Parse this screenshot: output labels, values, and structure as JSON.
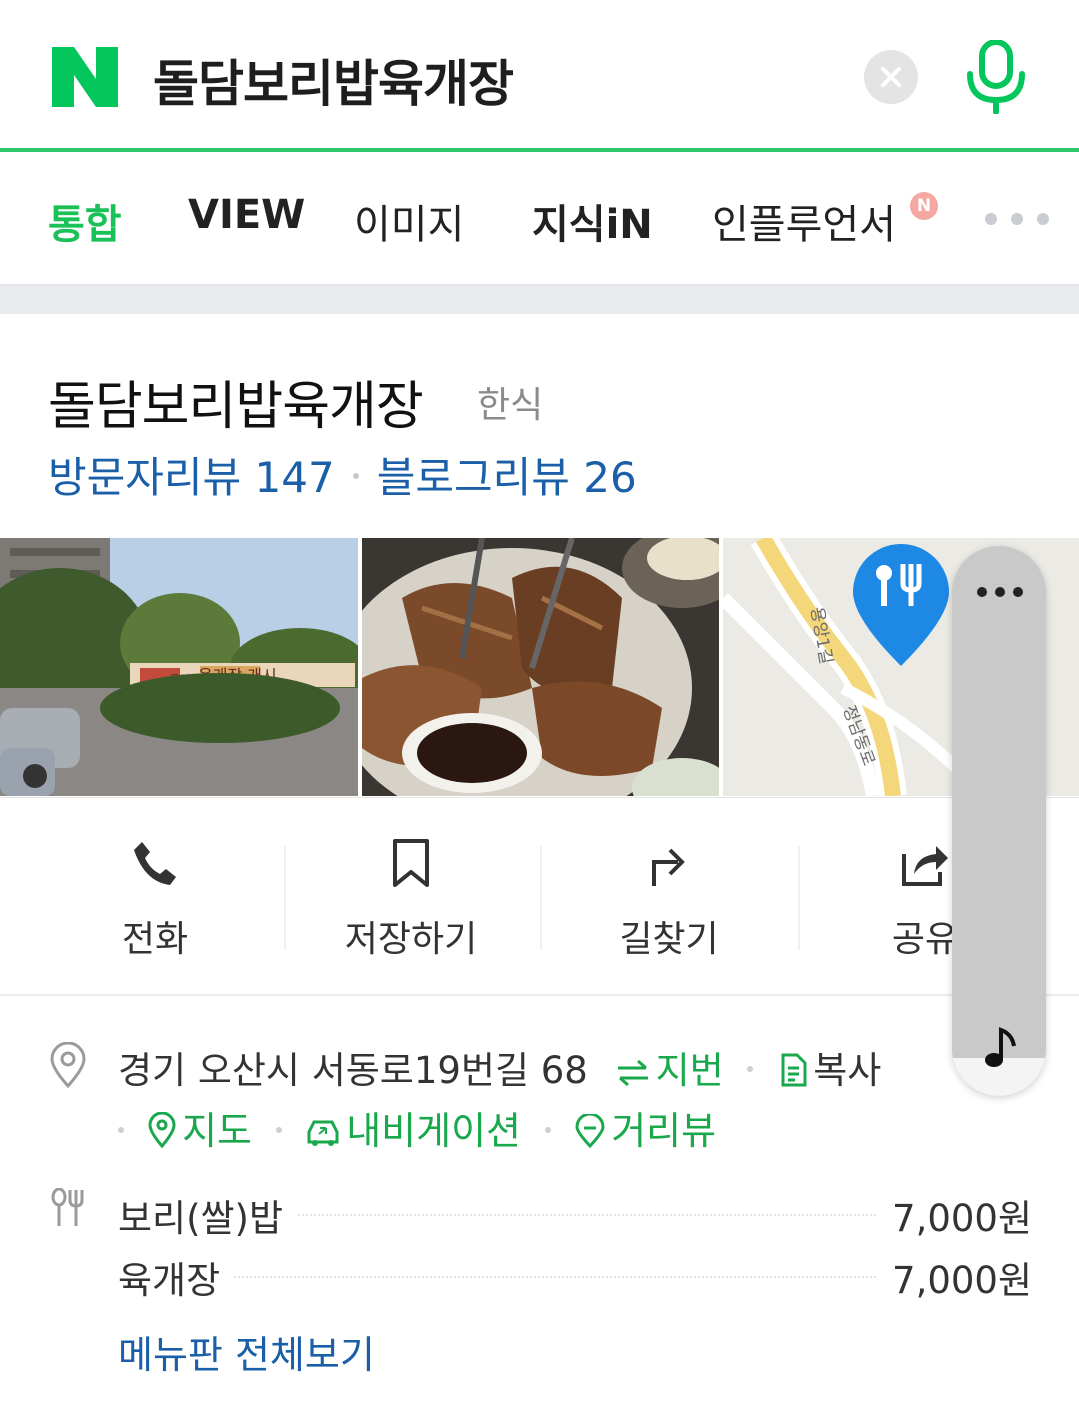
{
  "search": {
    "query": "돌담보리밥육개장",
    "logo_letter": "N",
    "clear_icon": "close-icon",
    "mic_icon": "microphone-icon"
  },
  "tabs": [
    {
      "label": "통합",
      "active": true
    },
    {
      "label": "VIEW",
      "active": false
    },
    {
      "label": "이미지",
      "active": false
    },
    {
      "label": "지식iN",
      "active": false
    },
    {
      "label": "인플루언서",
      "active": false,
      "badge": "N"
    }
  ],
  "place": {
    "name": "돌담보리밥육개장",
    "category": "한식",
    "visitor_reviews": "방문자리뷰 147",
    "blog_reviews": "블로그리뷰 26",
    "photos": [
      {
        "alt": "restaurant-exterior-photo",
        "sign_text": "육개장 개시",
        "sign_brand": "돌담"
      },
      {
        "alt": "grilled-pork-photo"
      },
      {
        "alt": "map-thumbnail",
        "road_1": "용앙1길",
        "road_2": "정남동로"
      }
    ],
    "actions": [
      {
        "label": "전화",
        "icon": "phone-icon"
      },
      {
        "label": "저장하기",
        "icon": "bookmark-icon"
      },
      {
        "label": "길찾기",
        "icon": "directions-icon"
      },
      {
        "label": "공유",
        "icon": "share-icon"
      }
    ],
    "address": "경기 오산시 서동로19번길 68",
    "address_links": {
      "jibun": "지번",
      "copy": "복사",
      "map": "지도",
      "navigation": "내비게이션",
      "street_view": "거리뷰"
    },
    "menu": [
      {
        "name": "보리(쌀)밥",
        "price": "7,000원"
      },
      {
        "name": "육개장",
        "price": "7,000원"
      }
    ],
    "menu_all": "메뉴판 전체보기"
  },
  "colors": {
    "naver_green": "#03c75a",
    "link_blue": "#1a5fa8",
    "link_green": "#19a84c",
    "map_pin_blue": "#1e88e5"
  }
}
